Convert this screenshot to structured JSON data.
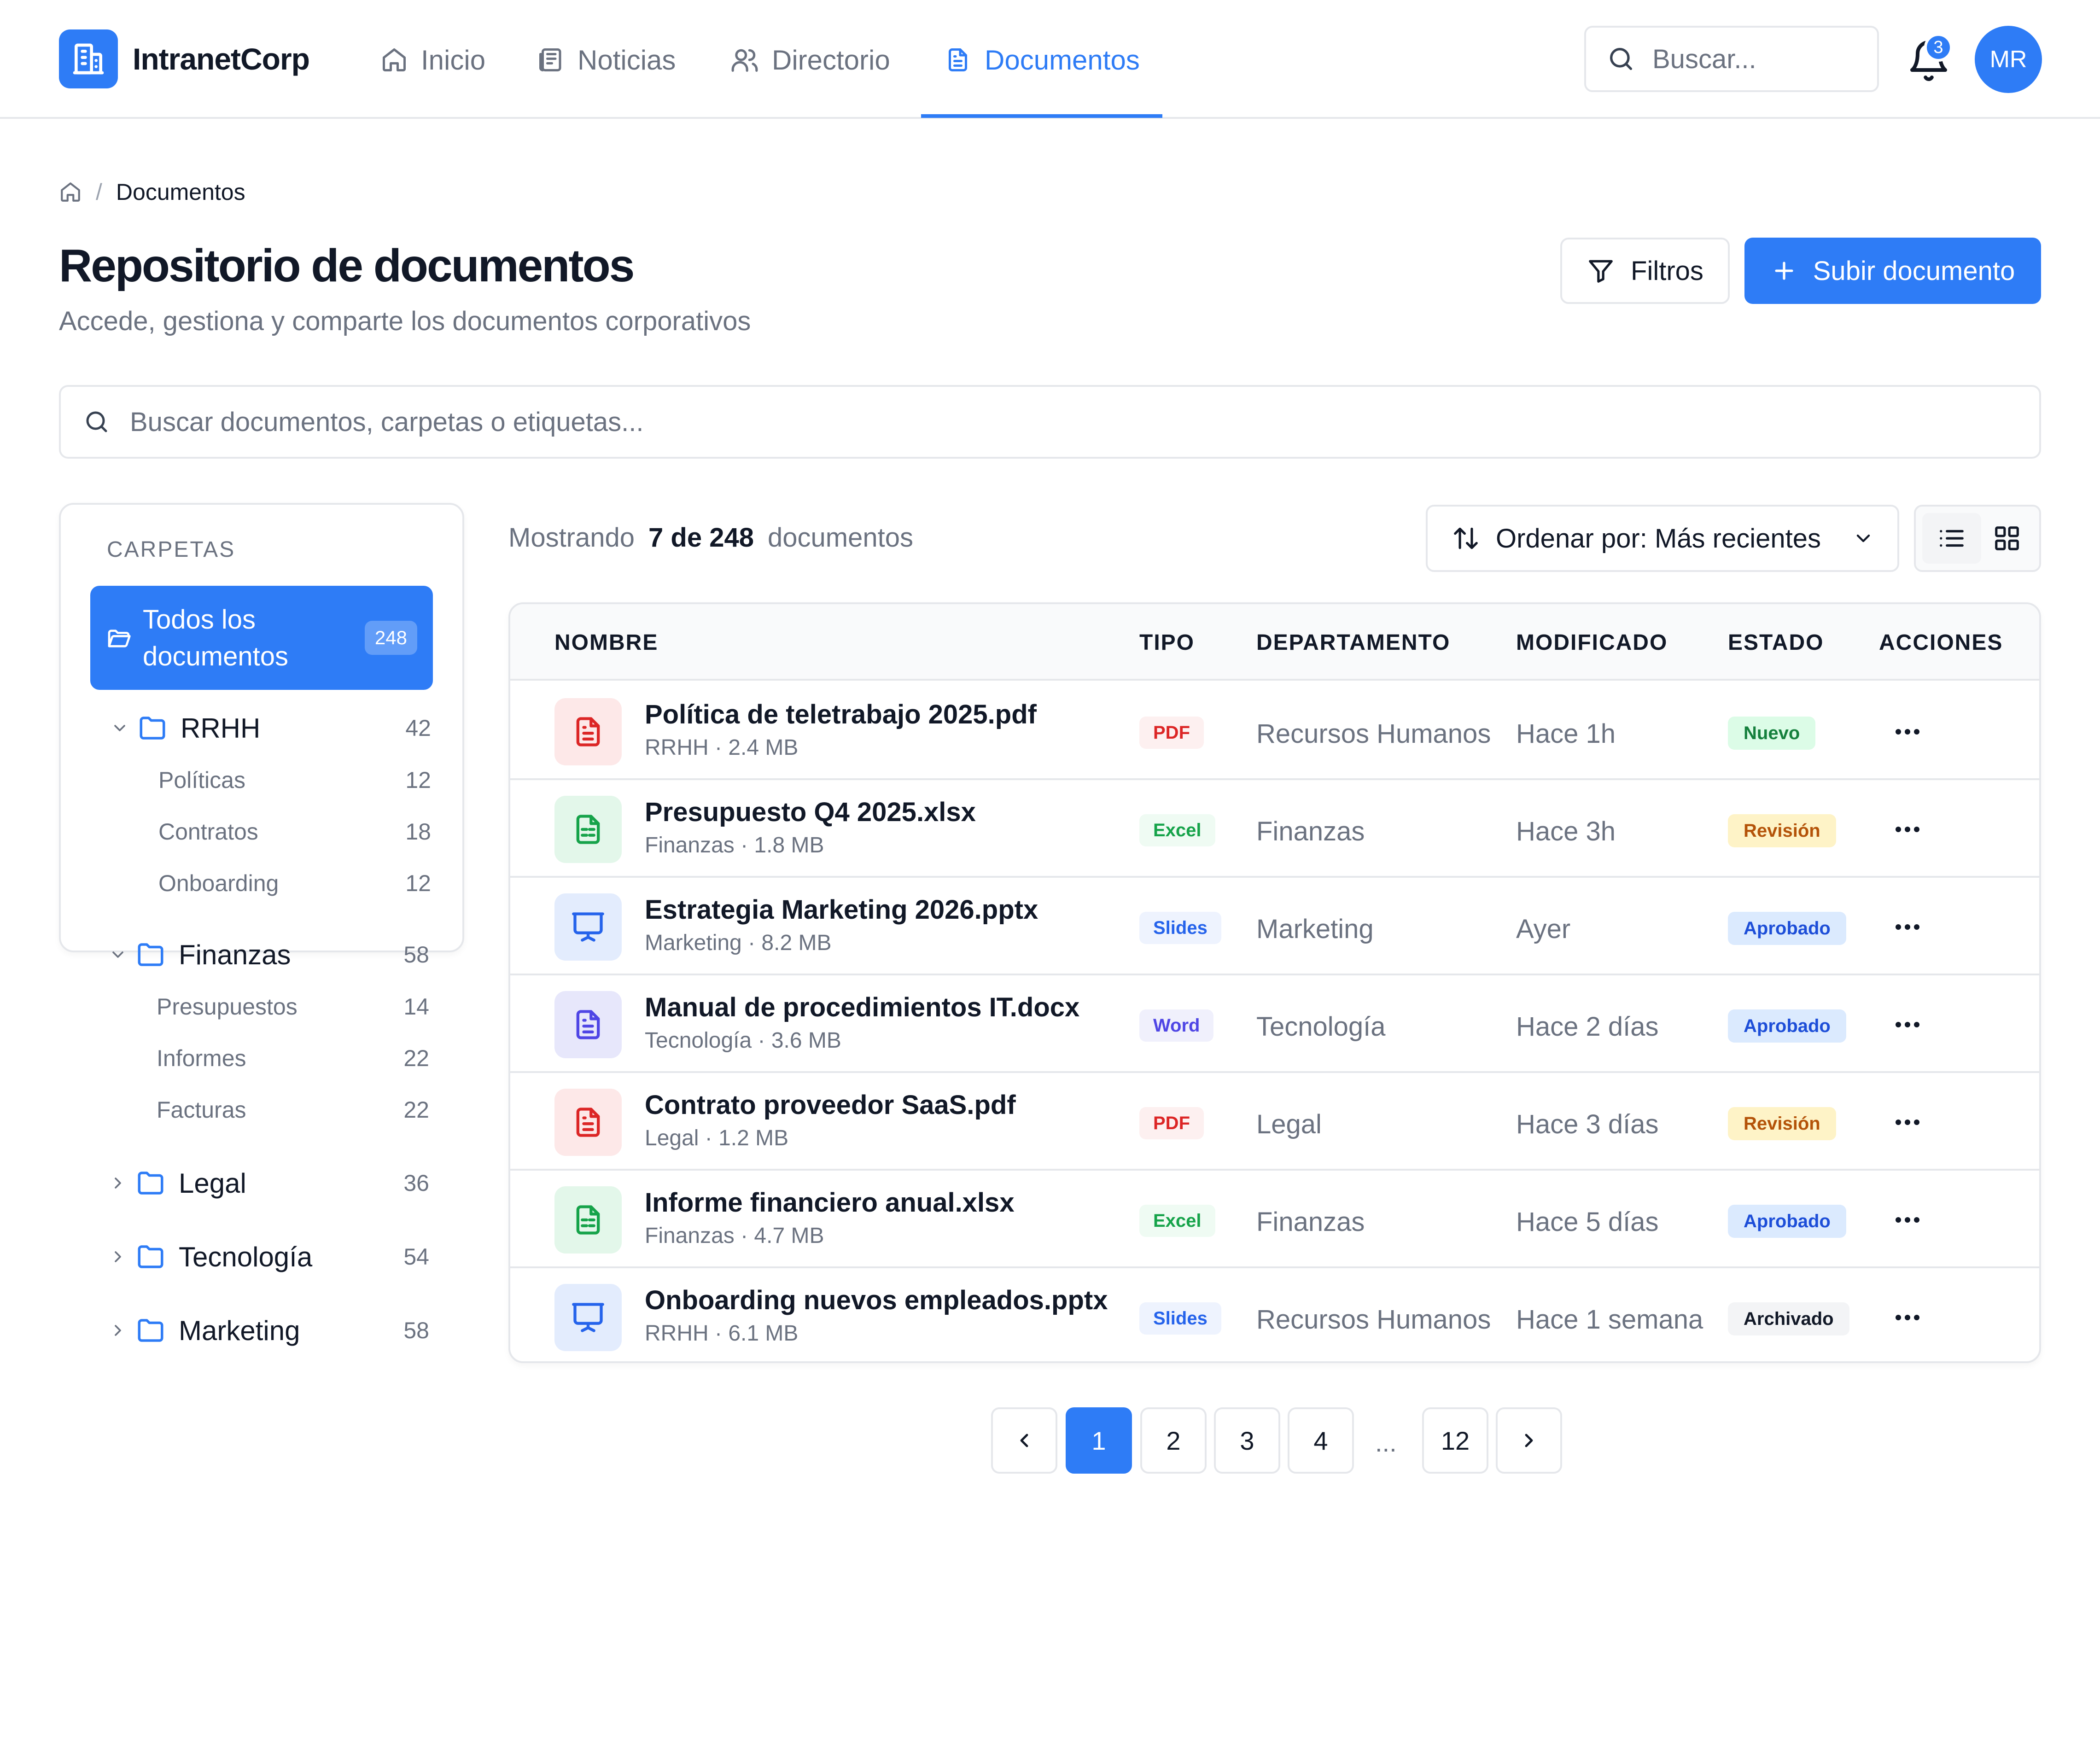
{
  "colors": {
    "accent": "#2e7cf6",
    "pdf_fg": "#dc2626",
    "pdf_bg": "#fde8e8",
    "excel_fg": "#16a34a",
    "excel_bg": "#e3f7ea",
    "slides_fg": "#2563eb",
    "slides_bg": "#e3ecfd",
    "word_fg": "#4f46e5",
    "word_bg": "#e7e7fb"
  },
  "header": {
    "brand": "IntranetCorp",
    "logo_icon": "building-icon",
    "nav": [
      {
        "label": "Inicio",
        "icon": "home-icon"
      },
      {
        "label": "Noticias",
        "icon": "newspaper-icon"
      },
      {
        "label": "Directorio",
        "icon": "users-icon"
      },
      {
        "label": "Documentos",
        "icon": "document-icon",
        "active": true
      }
    ],
    "search_placeholder": "Buscar...",
    "notifications_count": "3",
    "avatar_initials": "MR"
  },
  "breadcrumb": {
    "home_icon": "home-icon",
    "separator": "/",
    "current": "Documentos"
  },
  "page": {
    "title": "Repositorio de documentos",
    "subtitle": "Accede, gestiona y comparte los documentos corporativos",
    "filters_label": "Filtros",
    "upload_label": "Subir documento",
    "search_placeholder": "Buscar documentos, carpetas o etiquetas..."
  },
  "sidebar": {
    "heading": "CARPETAS",
    "all": {
      "label": "Todos los documentos",
      "count": "248"
    },
    "folders": [
      {
        "name": "RRHH",
        "count": "42",
        "expanded": true,
        "children": [
          {
            "name": "Políticas",
            "count": "12"
          },
          {
            "name": "Contratos",
            "count": "18"
          },
          {
            "name": "Onboarding",
            "count": "12"
          }
        ]
      },
      {
        "name": "Finanzas",
        "count": "58",
        "expanded": true,
        "children": [
          {
            "name": "Presupuestos",
            "count": "14"
          },
          {
            "name": "Informes",
            "count": "22"
          },
          {
            "name": "Facturas",
            "count": "22"
          }
        ]
      },
      {
        "name": "Legal",
        "count": "36",
        "expanded": false,
        "children": []
      },
      {
        "name": "Tecnología",
        "count": "54",
        "expanded": false,
        "children": []
      },
      {
        "name": "Marketing",
        "count": "58",
        "expanded": false,
        "children": []
      }
    ]
  },
  "toolbar": {
    "showing_prefix": "Mostrando",
    "showing_count": "7 de 248",
    "showing_suffix": "documentos",
    "sort_label": "Ordenar por: Más recientes",
    "view": "list"
  },
  "table": {
    "columns": [
      "NOMBRE",
      "TIPO",
      "DEPARTAMENTO",
      "MODIFICADO",
      "ESTADO",
      "ACCIONES"
    ],
    "rows": [
      {
        "name": "Política de teletrabajo 2025.pdf",
        "meta": "RRHH · 2.4 MB",
        "type": "PDF",
        "kind": "pdf",
        "dept": "Recursos Humanos",
        "modified": "Hace 1h",
        "status": "Nuevo",
        "status_kind": "new"
      },
      {
        "name": "Presupuesto Q4 2025.xlsx",
        "meta": "Finanzas · 1.8 MB",
        "type": "Excel",
        "kind": "excel",
        "dept": "Finanzas",
        "modified": "Hace 3h",
        "status": "Revisión",
        "status_kind": "review"
      },
      {
        "name": "Estrategia Marketing 2026.pptx",
        "meta": "Marketing · 8.2 MB",
        "type": "Slides",
        "kind": "slides",
        "dept": "Marketing",
        "modified": "Ayer",
        "status": "Aprobado",
        "status_kind": "approved"
      },
      {
        "name": "Manual de procedimientos IT.docx",
        "meta": "Tecnología · 3.6 MB",
        "type": "Word",
        "kind": "word",
        "dept": "Tecnología",
        "modified": "Hace 2 días",
        "status": "Aprobado",
        "status_kind": "approved"
      },
      {
        "name": "Contrato proveedor SaaS.pdf",
        "meta": "Legal · 1.2 MB",
        "type": "PDF",
        "kind": "pdf",
        "dept": "Legal",
        "modified": "Hace 3 días",
        "status": "Revisión",
        "status_kind": "review"
      },
      {
        "name": "Informe financiero anual.xlsx",
        "meta": "Finanzas · 4.7 MB",
        "type": "Excel",
        "kind": "excel",
        "dept": "Finanzas",
        "modified": "Hace 5 días",
        "status": "Aprobado",
        "status_kind": "approved"
      },
      {
        "name": "Onboarding nuevos empleados.pptx",
        "meta": "RRHH · 6.1 MB",
        "type": "Slides",
        "kind": "slides",
        "dept": "Recursos Humanos",
        "modified": "Hace 1 semana",
        "status": "Archivado",
        "status_kind": "archived"
      }
    ]
  },
  "pagination": {
    "pages": [
      "1",
      "2",
      "3",
      "4"
    ],
    "ellipsis": "...",
    "last": "12",
    "current": "1"
  }
}
